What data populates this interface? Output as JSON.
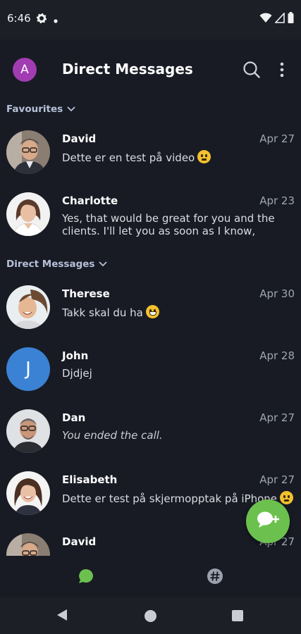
{
  "status_bar": {
    "time": "6:46",
    "left_icons": [
      "gear-icon",
      "dot-icon"
    ],
    "right_icons": [
      "wifi-icon",
      "signal-icon",
      "battery-icon"
    ]
  },
  "header": {
    "avatar_letter": "A",
    "avatar_color": "#a23cb3",
    "title": "Direct Messages",
    "actions": [
      "search-icon",
      "more-vert-icon"
    ]
  },
  "sections": {
    "favourites": {
      "label": "Favourites"
    },
    "direct": {
      "label": "Direct Messages"
    }
  },
  "favourites": [
    {
      "name": "David",
      "date": "Apr 27",
      "message": "Dette er en test på video",
      "emoji": "slight-smile"
    },
    {
      "name": "Charlotte",
      "date": "Apr 23",
      "message": "Yes, that would be great for you and the clients. I'll let you as soon as I know, hopeful..."
    }
  ],
  "direct_messages": [
    {
      "name": "Therese",
      "date": "Apr 30",
      "message": "Takk skal du ha",
      "emoji": "grin"
    },
    {
      "name": "John",
      "date": "Apr 28",
      "message": "Djdjej",
      "avatar_letter": "J",
      "avatar_color": "#3b82d4"
    },
    {
      "name": "Dan",
      "date": "Apr 27",
      "message": "You ended the call."
    },
    {
      "name": "Elisabeth",
      "date": "Apr 27",
      "message": "Dette er test på skjermopptak på iPhone",
      "emoji": "slight-smile"
    },
    {
      "name": "David",
      "date": "Apr 27",
      "message": ""
    }
  ],
  "fab": {
    "icon": "new-message-icon",
    "color": "#6cc14e"
  },
  "bottom_nav": [
    {
      "icon": "chat-bubble-icon",
      "active": true,
      "color": "#6cc14e"
    },
    {
      "icon": "hashtag-icon",
      "active": false
    }
  ],
  "system_nav": [
    "back-icon",
    "home-icon",
    "recents-icon"
  ]
}
